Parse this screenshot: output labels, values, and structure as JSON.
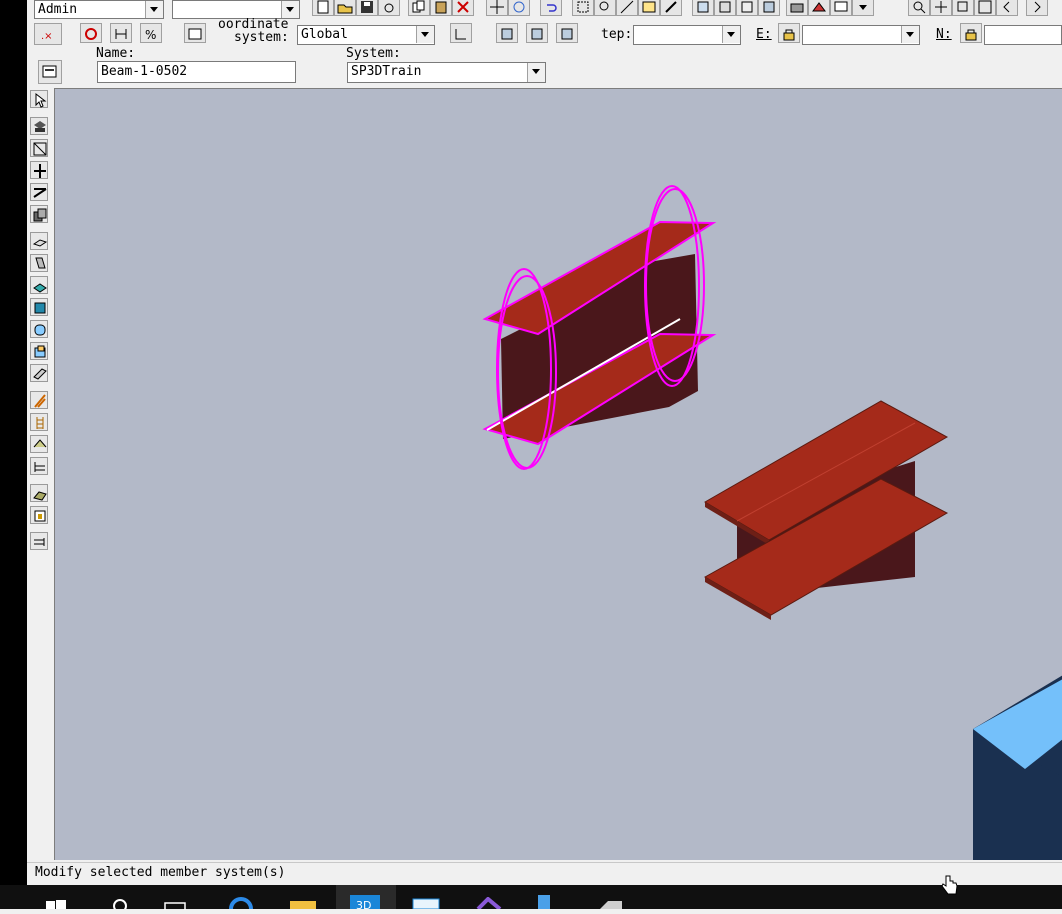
{
  "toolbar": {
    "user_combo": "Admin",
    "second_combo": "",
    "coordinate_label_line1": "oordinate",
    "coordinate_label_line2": "system:",
    "coordinate_value": "Global",
    "step_label": "tep:",
    "step_value": "",
    "e_label": "E:",
    "e_value": "",
    "n_label": "N:",
    "n_value": ""
  },
  "properties": {
    "name_label": "Name:",
    "name_value": "Beam-1-0502",
    "system_label": "System:",
    "system_value": "SP3DTrain"
  },
  "status": {
    "message": "Modify selected member system(s)"
  },
  "colors": {
    "viewport_bg": "#b3b9c8",
    "beam_top": "#a52a1a",
    "beam_web": "#4a171b",
    "highlight": "#ff00ff",
    "block_side": "#1a3050",
    "block_top": "#74c0fa"
  },
  "icons": {
    "taskbar": [
      "windows-start-icon",
      "search-icon",
      "task-view-icon",
      "edge-browser-icon",
      "file-explorer-icon",
      "smart3d-app-icon",
      "network-app-icon",
      "visual-studio-icon",
      "document-app-icon",
      "misc-app-icon"
    ]
  }
}
